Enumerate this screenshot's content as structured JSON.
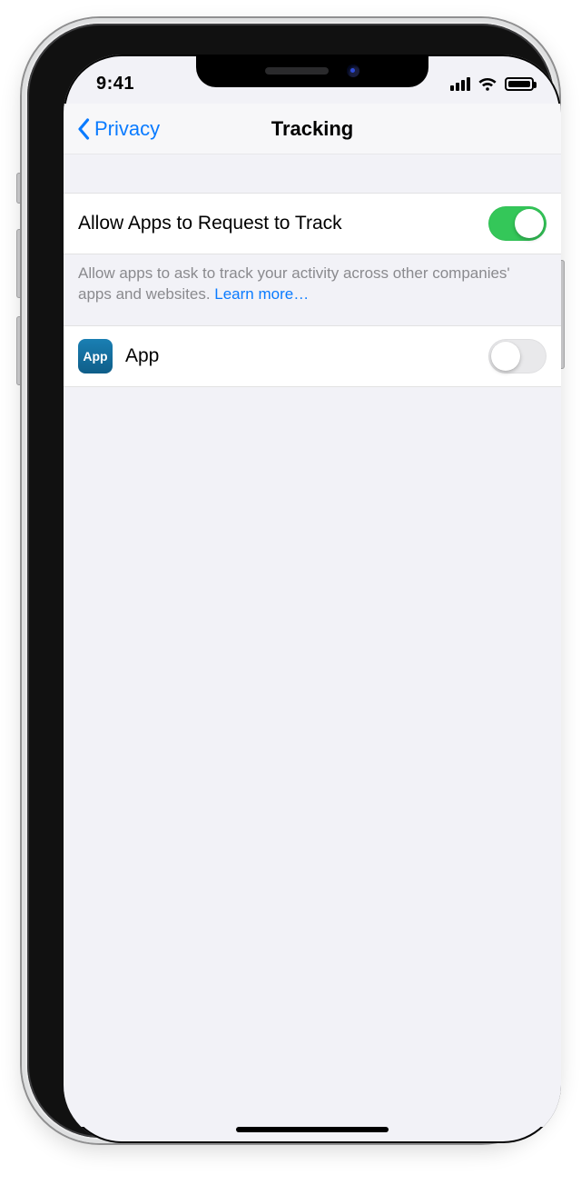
{
  "status": {
    "time": "9:41"
  },
  "nav": {
    "back_label": "Privacy",
    "title": "Tracking"
  },
  "tracking": {
    "allow_label": "Allow Apps to Request to Track",
    "allow_on": true,
    "note_text": "Allow apps to ask to track your activity across other companies' apps and websites. ",
    "learn_more": "Learn more…"
  },
  "apps": [
    {
      "name": "App",
      "icon_label": "App",
      "tracking_on": false
    }
  ]
}
